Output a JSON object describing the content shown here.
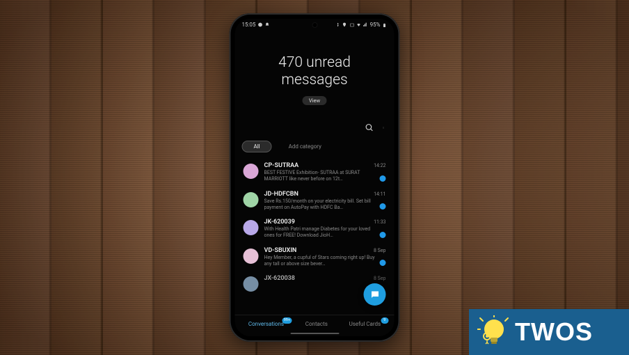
{
  "status": {
    "time": "15:05",
    "battery": "95%"
  },
  "header": {
    "title_line1": "470 unread",
    "title_line2": "messages",
    "view_label": "View"
  },
  "category_tabs": {
    "all": "All",
    "add": "Add category"
  },
  "conversations": [
    {
      "sender": "CP-SUTRAA",
      "time": "14:22",
      "preview": "BEST FESTIVE Exhibition- SUTRAA at SURAT MARRIOTT like never before on 12t…",
      "avatar": "#d9a6d6"
    },
    {
      "sender": "JD-HDFCBN",
      "time": "14:11",
      "preview": "Save Rs.150/month on your electricity bill. Set bill payment on AutoPay with HDFC Ba…",
      "avatar": "#9fd4a6"
    },
    {
      "sender": "JK-620039",
      "time": "11:33",
      "preview": "With Health Patri manage Diabetes for your loved ones for FREE! Download JioH…",
      "avatar": "#b8a8e8"
    },
    {
      "sender": "VD-SBUXIN",
      "time": "8 Sep",
      "preview": "Hey Member, a cupful of Stars coming right up! Buy any tall or above size bever…",
      "avatar": "#e6c0d6"
    },
    {
      "sender": "JX-620038",
      "time": "8 Sep",
      "preview": "",
      "avatar": "#a6c8e8"
    }
  ],
  "bottom_tabs": {
    "conversations": {
      "label": "Conversations",
      "badge": "99+"
    },
    "contacts": {
      "label": "Contacts"
    },
    "useful": {
      "label": "Useful Cards",
      "badge": "9"
    }
  },
  "overlay": {
    "brand": "TWOS"
  }
}
